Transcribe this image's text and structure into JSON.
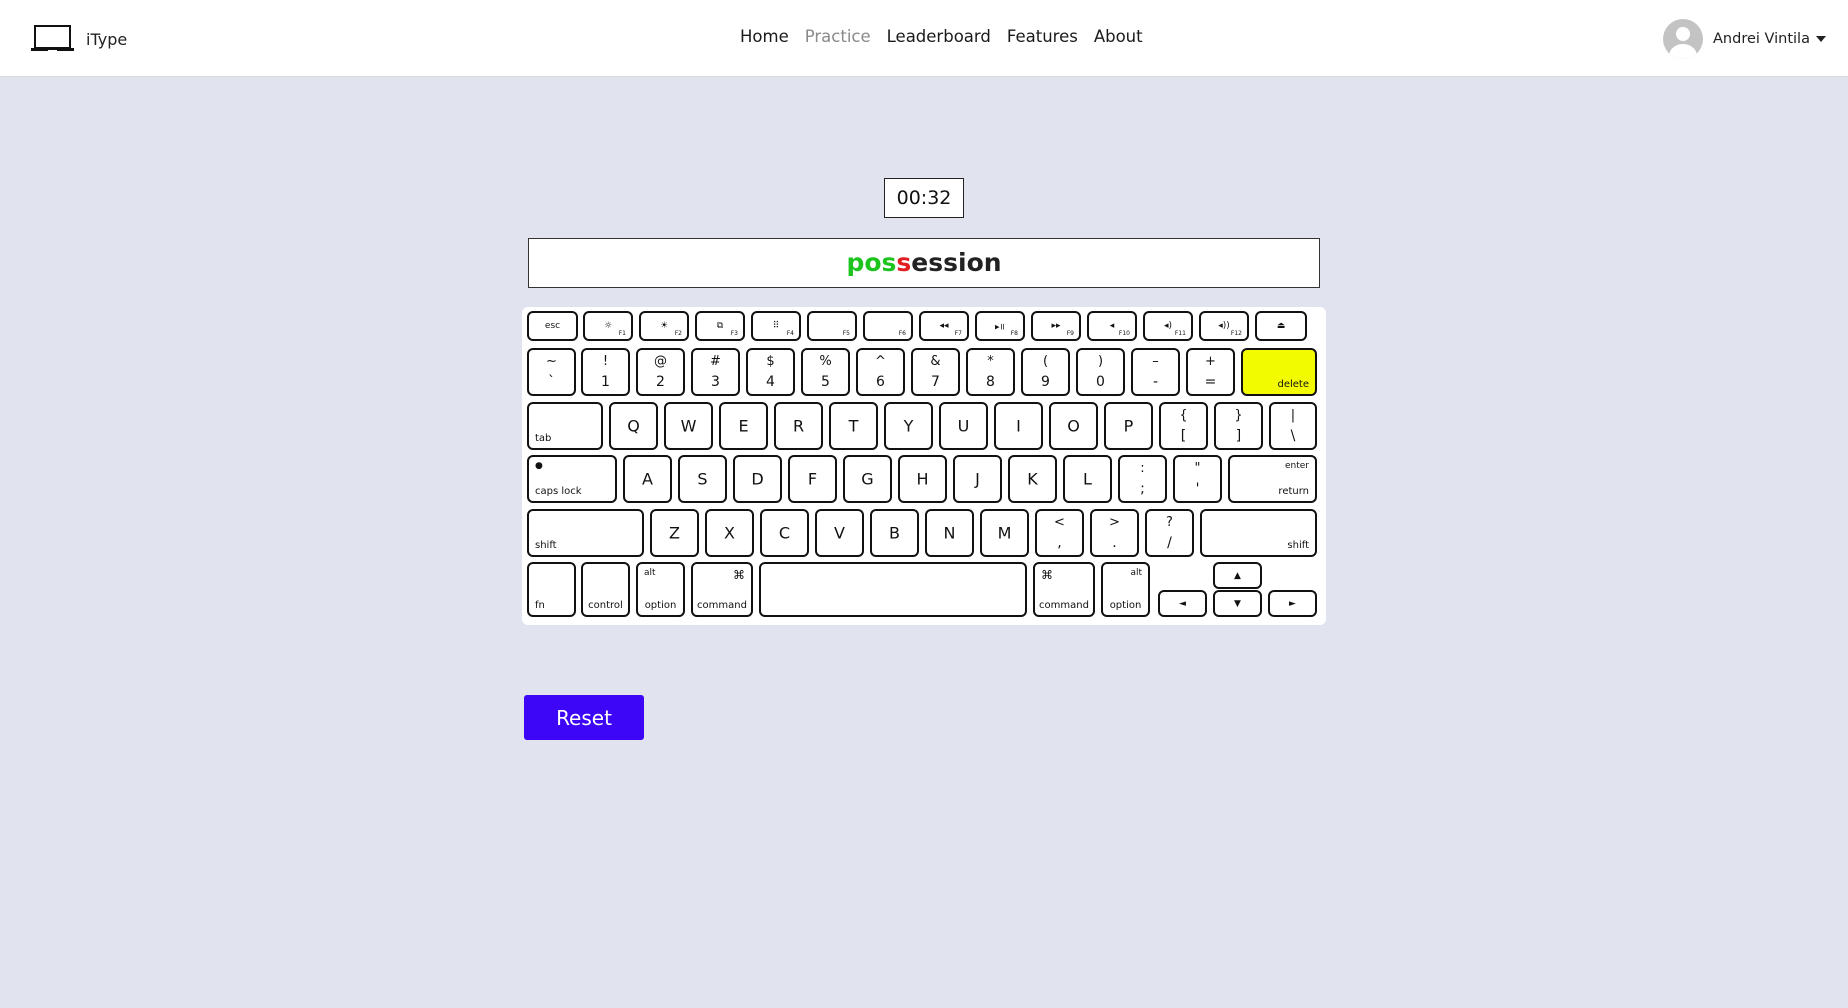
{
  "brand": {
    "name": "iType",
    "icon": "laptop-icon"
  },
  "nav": {
    "items": [
      "Home",
      "Practice",
      "Leaderboard",
      "Features",
      "About"
    ],
    "active": "Practice"
  },
  "user": {
    "name": "Andrei Vintila",
    "avatar_icon": "user-avatar-icon"
  },
  "timer": "00:32",
  "word": {
    "correct": "pos",
    "incorrect": "s",
    "remaining": "ession"
  },
  "colors": {
    "correct": "#1ec41e",
    "incorrect": "#e11d1d",
    "highlight_key": "#f2fb00",
    "reset_button": "#3e06f7",
    "background": "#e1e3ef"
  },
  "keyboard": {
    "highlighted_key": "delete",
    "function_row": [
      "esc",
      "F1",
      "F2",
      "F3",
      "F4",
      "F5",
      "F6",
      "F7",
      "F8",
      "F9",
      "F10",
      "F11",
      "F12"
    ],
    "number_row": [
      {
        "top": "~",
        "bottom": "`"
      },
      {
        "top": "!",
        "bottom": "1"
      },
      {
        "top": "@",
        "bottom": "2"
      },
      {
        "top": "#",
        "bottom": "3"
      },
      {
        "top": "$",
        "bottom": "4"
      },
      {
        "top": "%",
        "bottom": "5"
      },
      {
        "top": "^",
        "bottom": "6"
      },
      {
        "top": "&",
        "bottom": "7"
      },
      {
        "top": "*",
        "bottom": "8"
      },
      {
        "top": "(",
        "bottom": "9"
      },
      {
        "top": ")",
        "bottom": "0"
      },
      {
        "top": "–",
        "bottom": "-"
      },
      {
        "top": "+",
        "bottom": "="
      },
      {
        "label": "delete"
      }
    ],
    "top_row": [
      {
        "label": "tab"
      },
      {
        "label": "Q"
      },
      {
        "label": "W"
      },
      {
        "label": "E"
      },
      {
        "label": "R"
      },
      {
        "label": "T"
      },
      {
        "label": "Y"
      },
      {
        "label": "U"
      },
      {
        "label": "I"
      },
      {
        "label": "O"
      },
      {
        "label": "P"
      },
      {
        "top": "{",
        "bottom": "["
      },
      {
        "top": "}",
        "bottom": "]"
      },
      {
        "top": "|",
        "bottom": "\\"
      }
    ],
    "home_row": [
      {
        "label": "caps lock"
      },
      {
        "label": "A"
      },
      {
        "label": "S"
      },
      {
        "label": "D"
      },
      {
        "label": "F"
      },
      {
        "label": "G"
      },
      {
        "label": "H"
      },
      {
        "label": "J"
      },
      {
        "label": "K"
      },
      {
        "label": "L"
      },
      {
        "top": ":",
        "bottom": ";"
      },
      {
        "top": "\"",
        "bottom": "'"
      },
      {
        "top": "enter",
        "bottom": "return"
      }
    ],
    "bottom_row": [
      {
        "label": "shift"
      },
      {
        "label": "Z"
      },
      {
        "label": "X"
      },
      {
        "label": "C"
      },
      {
        "label": "V"
      },
      {
        "label": "B"
      },
      {
        "label": "N"
      },
      {
        "label": "M"
      },
      {
        "top": "<",
        "bottom": ","
      },
      {
        "top": ">",
        "bottom": "."
      },
      {
        "top": "?",
        "bottom": "/"
      },
      {
        "label": "shift"
      }
    ],
    "modifier_row": [
      {
        "label": "fn"
      },
      {
        "label": "control"
      },
      {
        "top": "alt",
        "bottom": "option"
      },
      {
        "top": "⌘",
        "bottom": "command"
      },
      {
        "label": ""
      },
      {
        "top": "⌘",
        "bottom": "command"
      },
      {
        "top": "alt",
        "bottom": "option"
      },
      {
        "label": "◄"
      },
      {
        "label": "▲"
      },
      {
        "label": "▼"
      },
      {
        "label": "►"
      }
    ]
  },
  "actions": {
    "reset": "Reset"
  }
}
